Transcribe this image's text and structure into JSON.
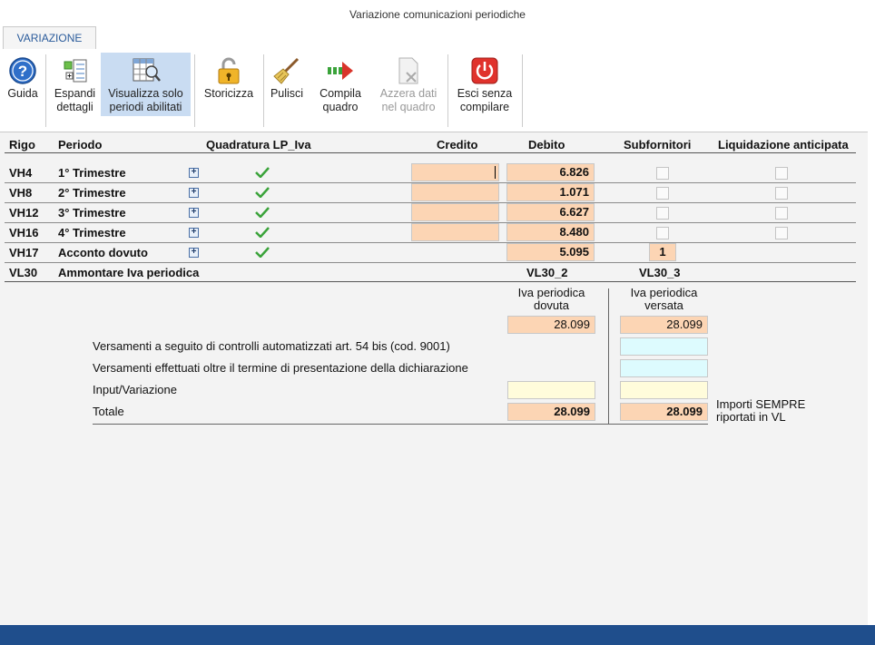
{
  "window": {
    "title": "Variazione comunicazioni periodiche"
  },
  "tabs": [
    {
      "label": "VARIAZIONE"
    }
  ],
  "ribbon": {
    "guida": "Guida",
    "espandi_1": "Espandi",
    "espandi_2": "dettagli",
    "visualizza_1": "Visualizza solo",
    "visualizza_2": "periodi abilitati",
    "storicizza": "Storicizza",
    "pulisci": "Pulisci",
    "compila_1": "Compila",
    "compila_2": "quadro",
    "azzera_1": "Azzera dati",
    "azzera_2": "nel quadro",
    "esci_1": "Esci senza",
    "esci_2": "compilare"
  },
  "table": {
    "headers": {
      "rigo": "Rigo",
      "periodo": "Periodo",
      "quadratura": "Quadratura LP_Iva",
      "credito": "Credito",
      "debito": "Debito",
      "subfornitori": "Subfornitori",
      "liquidazione": "Liquidazione anticipata"
    },
    "rows": [
      {
        "rigo": "VH4",
        "periodo": "1° Trimestre",
        "debito": "6.826"
      },
      {
        "rigo": "VH8",
        "periodo": "2° Trimestre",
        "debito": "1.071"
      },
      {
        "rigo": "VH12",
        "periodo": "3° Trimestre",
        "debito": "6.627"
      },
      {
        "rigo": "VH16",
        "periodo": "4° Trimestre",
        "debito": "8.480"
      },
      {
        "rigo": "VH17",
        "periodo": "Acconto dovuto",
        "debito": "5.095",
        "sub": "1"
      }
    ],
    "vl30": {
      "rigo": "VL30",
      "periodo": "Ammontare Iva periodica",
      "col2": "VL30_2",
      "col3": "VL30_3"
    }
  },
  "summary": {
    "dovuta_1": "Iva periodica",
    "dovuta_2": "dovuta",
    "versata_1": "Iva periodica",
    "versata_2": "versata",
    "dovuta_val": "28.099",
    "versata_val": "28.099",
    "row1": "Versamenti a seguito di controlli automatizzati art. 54 bis (cod. 9001)",
    "row2": "Versamenti effettuati oltre il termine di presentazione della dichiarazione",
    "row3": "Input/Variazione",
    "row4": "Totale",
    "totale_dovuta": "28.099",
    "totale_versata": "28.099",
    "note_1": "Importi SEMPRE",
    "note_2": "riportati in VL"
  }
}
